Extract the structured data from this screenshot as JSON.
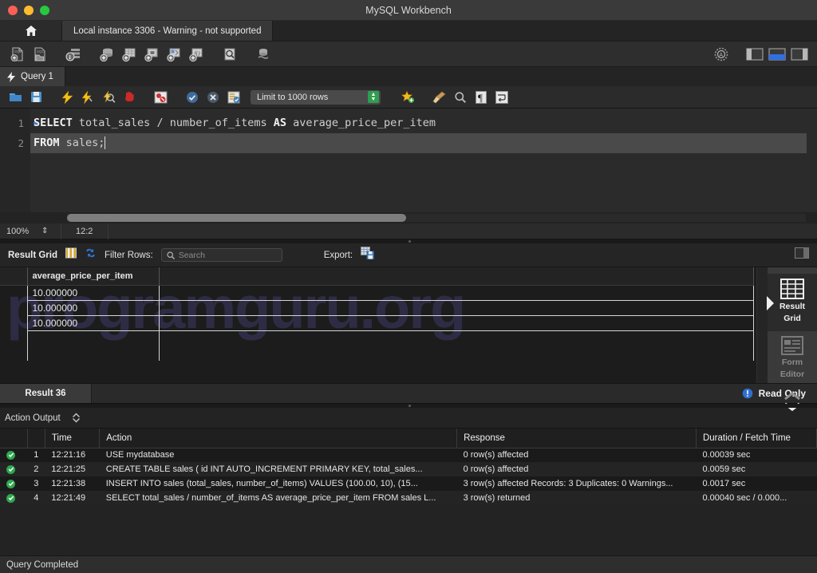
{
  "window": {
    "title": "MySQL Workbench",
    "traffic_lights": [
      "close",
      "minimize",
      "zoom"
    ]
  },
  "top_tabs": {
    "home_icon": "home-icon",
    "instance_tab": "Local instance 3306 - Warning - not supported"
  },
  "main_toolbar": {
    "icons": [
      "new-sql-file-icon",
      "open-sql-file-icon",
      "server-info-icon",
      "new-schema-icon",
      "new-table-icon",
      "new-view-icon",
      "new-routine-icon",
      "new-function-icon",
      "search-table-data-icon",
      "reconnect-server-icon"
    ],
    "right_icons": [
      "settings-gear-icon",
      "sidebar-left-toggle",
      "output-panel-toggle",
      "sidebar-right-toggle"
    ]
  },
  "query_tab": {
    "icon": "lightning-icon",
    "label": "Query 1"
  },
  "editor_toolbar": {
    "icons": [
      "open-script-icon",
      "save-script-icon",
      "execute-icon",
      "execute-current-statement-icon",
      "explain-icon",
      "stop-icon",
      "toggle-stop-on-error-icon",
      "commit-icon",
      "rollback-icon",
      "autocommit-icon"
    ],
    "limit_label": "Limit to 1000 rows",
    "right_icons": [
      "beautify-icon",
      "clear-context-icon",
      "find-icon",
      "invisible-chars-icon",
      "wrap-lines-icon"
    ]
  },
  "editor": {
    "zoom": "100%",
    "position": "12:2",
    "lines": [
      {
        "num": "1",
        "breakpoint": true,
        "tokens": [
          {
            "t": "SELECT",
            "c": "kw"
          },
          {
            "t": " ",
            "c": "id"
          },
          {
            "t": "total_sales",
            "c": "id"
          },
          {
            "t": " ",
            "c": "id"
          },
          {
            "t": "/",
            "c": "op"
          },
          {
            "t": " ",
            "c": "id"
          },
          {
            "t": "number_of_items",
            "c": "id"
          },
          {
            "t": " ",
            "c": "id"
          },
          {
            "t": "AS",
            "c": "kw"
          },
          {
            "t": " ",
            "c": "id"
          },
          {
            "t": "average_price_per_item",
            "c": "id"
          }
        ]
      },
      {
        "num": "2",
        "breakpoint": false,
        "highlight": true,
        "tokens": [
          {
            "t": "FROM",
            "c": "kw"
          },
          {
            "t": " ",
            "c": "id"
          },
          {
            "t": "sales;",
            "c": "id"
          }
        ]
      }
    ],
    "full_text": "SELECT total_sales / number_of_items AS average_price_per_item\nFROM sales;"
  },
  "grid_toolbar": {
    "title": "Result Grid",
    "grid_view_icon": "grid-view-icon",
    "refresh_icon": "refresh-icon",
    "filter_label": "Filter Rows:",
    "search_placeholder": "Search",
    "search_value": "",
    "export_label": "Export:",
    "export_icon": "export-recordset-icon",
    "wrap_toggle_icon": "panel-toggle-icon"
  },
  "result_grid": {
    "columns": [
      "average_price_per_item"
    ],
    "rows": [
      [
        "10.000000"
      ],
      [
        "10.000000"
      ],
      [
        "10.000000"
      ]
    ],
    "watermark": "programguru.org"
  },
  "side_panel": {
    "items": [
      {
        "label_line1": "Result",
        "label_line2": "Grid",
        "icon": "result-grid-icon",
        "active": true
      },
      {
        "label_line1": "Form",
        "label_line2": "Editor",
        "icon": "form-editor-icon",
        "active": false
      }
    ],
    "chevrons_icon": "chevron-updown-icon"
  },
  "result_tabs": {
    "tab_label": "Result 36",
    "readonly_label": "Read Only",
    "readonly_icon": "info-icon"
  },
  "action_output": {
    "title": "Action Output",
    "filter_icon": "updown-stepper-icon",
    "columns": [
      "",
      "",
      "Time",
      "Action",
      "Response",
      "Duration / Fetch Time"
    ],
    "rows": [
      {
        "status": "success",
        "num": "1",
        "time": "12:21:16",
        "action": "USE mydatabase",
        "response": "0 row(s) affected",
        "duration": "0.00039 sec"
      },
      {
        "status": "success",
        "num": "2",
        "time": "12:21:25",
        "action": "CREATE TABLE sales (    id INT AUTO_INCREMENT PRIMARY KEY,    total_sales...",
        "response": "0 row(s) affected",
        "duration": "0.0059 sec"
      },
      {
        "status": "success",
        "num": "3",
        "time": "12:21:38",
        "action": "INSERT INTO sales (total_sales, number_of_items) VALUES (100.00, 10),        (15...",
        "response": "3 row(s) affected Records: 3  Duplicates: 0  Warnings...",
        "duration": "0.0017 sec"
      },
      {
        "status": "success",
        "num": "4",
        "time": "12:21:49",
        "action": "SELECT total_sales / number_of_items AS average_price_per_item FROM sales L...",
        "response": "3 row(s) returned",
        "duration": "0.00040 sec / 0.000..."
      }
    ]
  },
  "status_bar": {
    "message": "Query Completed"
  },
  "colors": {
    "window_bg": "#232323",
    "titlebar": "#3a3a3a",
    "accent_blue": "#3b7ddd",
    "success_green": "#2fa84f",
    "watermark": "#2e2c44",
    "grid_line": "#d6d6d6"
  }
}
